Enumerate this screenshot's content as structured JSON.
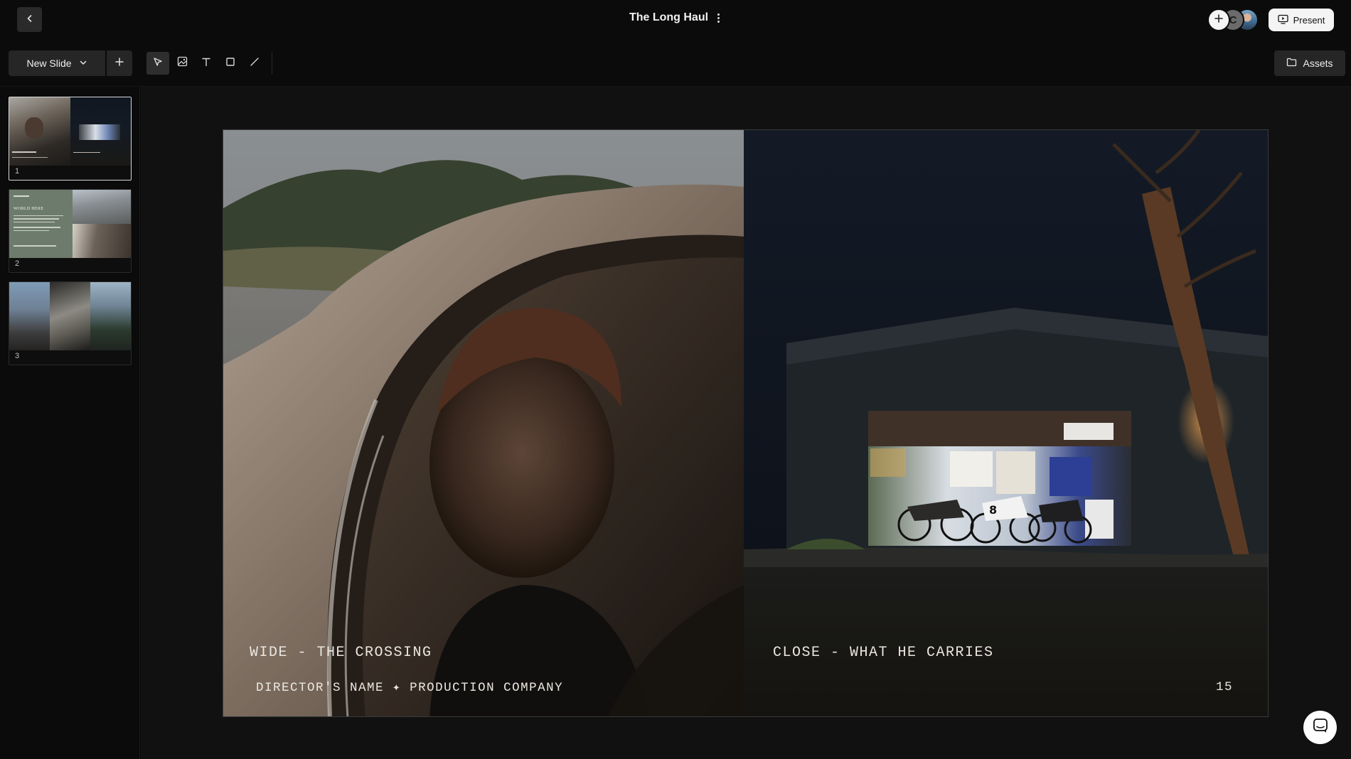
{
  "header": {
    "title": "The Long Haul",
    "back_icon": "chevron-left-icon",
    "menu_icon": "more-vertical-icon",
    "collaborators": [
      {
        "kind": "add",
        "icon": "plus-icon"
      },
      {
        "kind": "initial",
        "initial": "C"
      },
      {
        "kind": "photo"
      }
    ],
    "present_label": "Present",
    "present_icon": "present-screen-icon"
  },
  "toolbar": {
    "new_slide_label": "New Slide",
    "new_slide_icon": "chevron-down-icon",
    "add_icon": "plus-icon",
    "tools": [
      {
        "name": "select",
        "icon": "cursor-icon",
        "active": true
      },
      {
        "name": "image",
        "icon": "image-icon",
        "active": false
      },
      {
        "name": "text",
        "icon": "text-icon",
        "active": false
      },
      {
        "name": "rectangle",
        "icon": "square-icon",
        "active": false
      },
      {
        "name": "line",
        "icon": "line-icon",
        "active": false
      }
    ],
    "assets_label": "Assets",
    "assets_icon": "folder-icon"
  },
  "slides": [
    {
      "number": "1",
      "selected": true
    },
    {
      "number": "2",
      "selected": false,
      "heading": "WORLD HERE"
    },
    {
      "number": "3",
      "selected": false
    }
  ],
  "current_slide": {
    "left_caption": "WIDE - THE CROSSING",
    "right_caption": "CLOSE - WHAT HE CARRIES",
    "footer": "DIRECTOR'S NAME ✦ PRODUCTION COMPANY",
    "page_number": "15"
  },
  "chat": {
    "icon": "chat-bubble-icon"
  },
  "colors": {
    "background": "#0b0b0b",
    "canvas": "#111111",
    "control": "#262626",
    "caption_text": "#ece8e0"
  }
}
